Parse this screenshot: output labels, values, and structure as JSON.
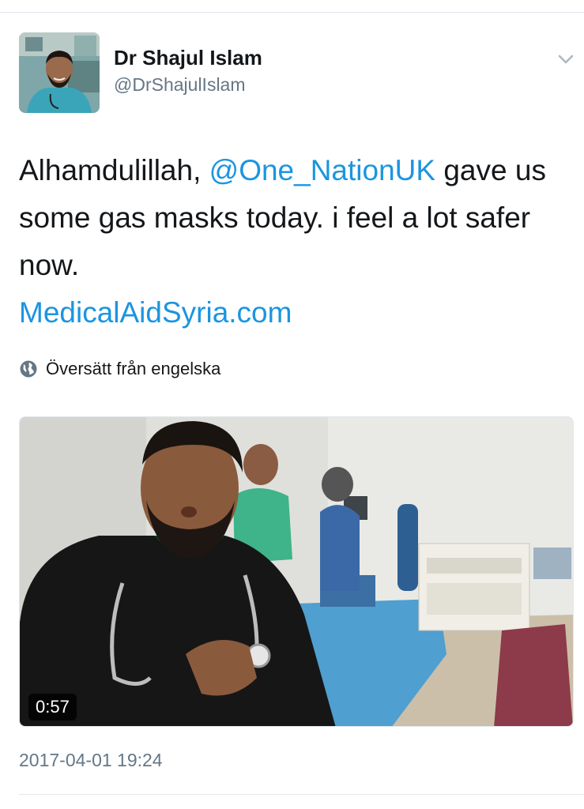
{
  "author": {
    "display_name": "Dr Shajul Islam",
    "handle": "@DrShajulIslam"
  },
  "tweet": {
    "text_prefix": "Alhamdulillah, ",
    "mention": "@One_NationUK",
    "text_suffix": " gave us some gas masks today. i feel a lot safer now.",
    "link": "MedicalAidSyria.com"
  },
  "translate": {
    "label": "Översätt från engelska",
    "icon": "globe-icon"
  },
  "media": {
    "type": "video",
    "duration": "0:57"
  },
  "timestamp": "2017-04-01 19:24",
  "colors": {
    "link": "#1b95e0",
    "secondary_text": "#657786",
    "divider": "#e1e8ed"
  }
}
